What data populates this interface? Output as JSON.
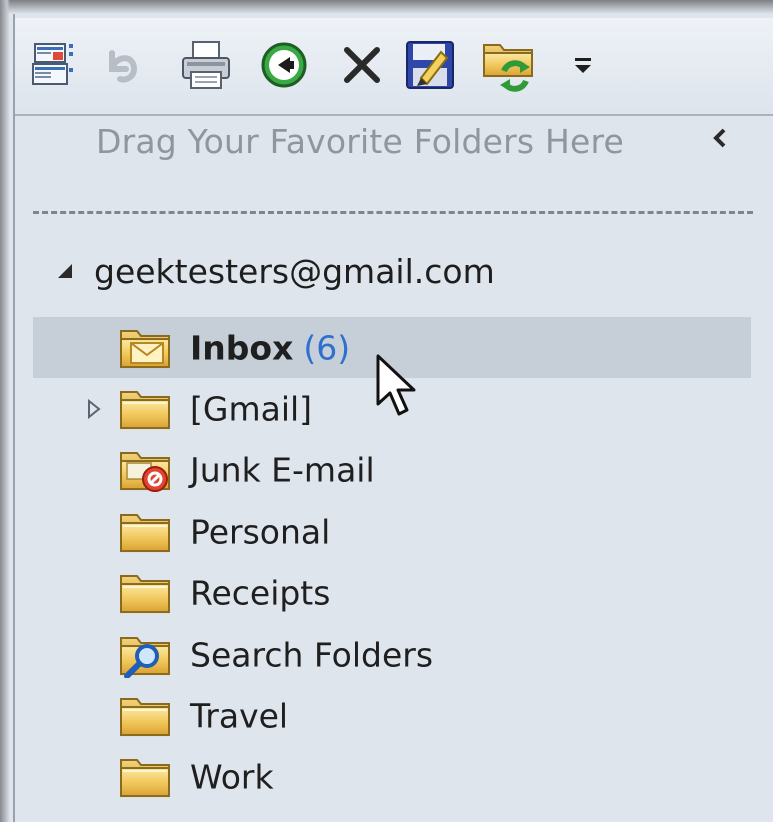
{
  "toolbar": {
    "buttons": [
      {
        "name": "new-items",
        "icon": "new-mail-icon"
      },
      {
        "name": "undo",
        "icon": "undo-icon"
      },
      {
        "name": "print",
        "icon": "printer-icon"
      },
      {
        "name": "back",
        "icon": "back-arrow-icon"
      },
      {
        "name": "delete",
        "icon": "delete-x-icon"
      },
      {
        "name": "save",
        "icon": "save-floppy-icon"
      },
      {
        "name": "send-receive",
        "icon": "folder-sync-icon"
      },
      {
        "name": "customize",
        "icon": "dropdown-customize-icon"
      }
    ]
  },
  "favorites": {
    "hint": "Drag Your Favorite Folders Here",
    "collapse_icon": "chevron-left-icon"
  },
  "account": {
    "email": "geektesters@gmail.com",
    "expanded": true
  },
  "folders": [
    {
      "name": "Inbox",
      "count": "(6)",
      "icon": "inbox-folder-icon",
      "selected": true,
      "expandable": false
    },
    {
      "name": "[Gmail]",
      "count": "",
      "icon": "folder-icon",
      "selected": false,
      "expandable": true
    },
    {
      "name": "Junk E-mail",
      "count": "",
      "icon": "junk-folder-icon",
      "selected": false,
      "expandable": false
    },
    {
      "name": "Personal",
      "count": "",
      "icon": "folder-icon",
      "selected": false,
      "expandable": false
    },
    {
      "name": "Receipts",
      "count": "",
      "icon": "folder-icon",
      "selected": false,
      "expandable": false
    },
    {
      "name": "Search Folders",
      "count": "",
      "icon": "search-folder-icon",
      "selected": false,
      "expandable": false
    },
    {
      "name": "Travel",
      "count": "",
      "icon": "folder-icon",
      "selected": false,
      "expandable": false
    },
    {
      "name": "Work",
      "count": "",
      "icon": "folder-icon",
      "selected": false,
      "expandable": false
    }
  ],
  "colors": {
    "pane_bg": "#dfe5ed",
    "selected_row": "#c6ced8",
    "unread_count": "#2f6fcf",
    "hint_text": "#8e969f"
  }
}
